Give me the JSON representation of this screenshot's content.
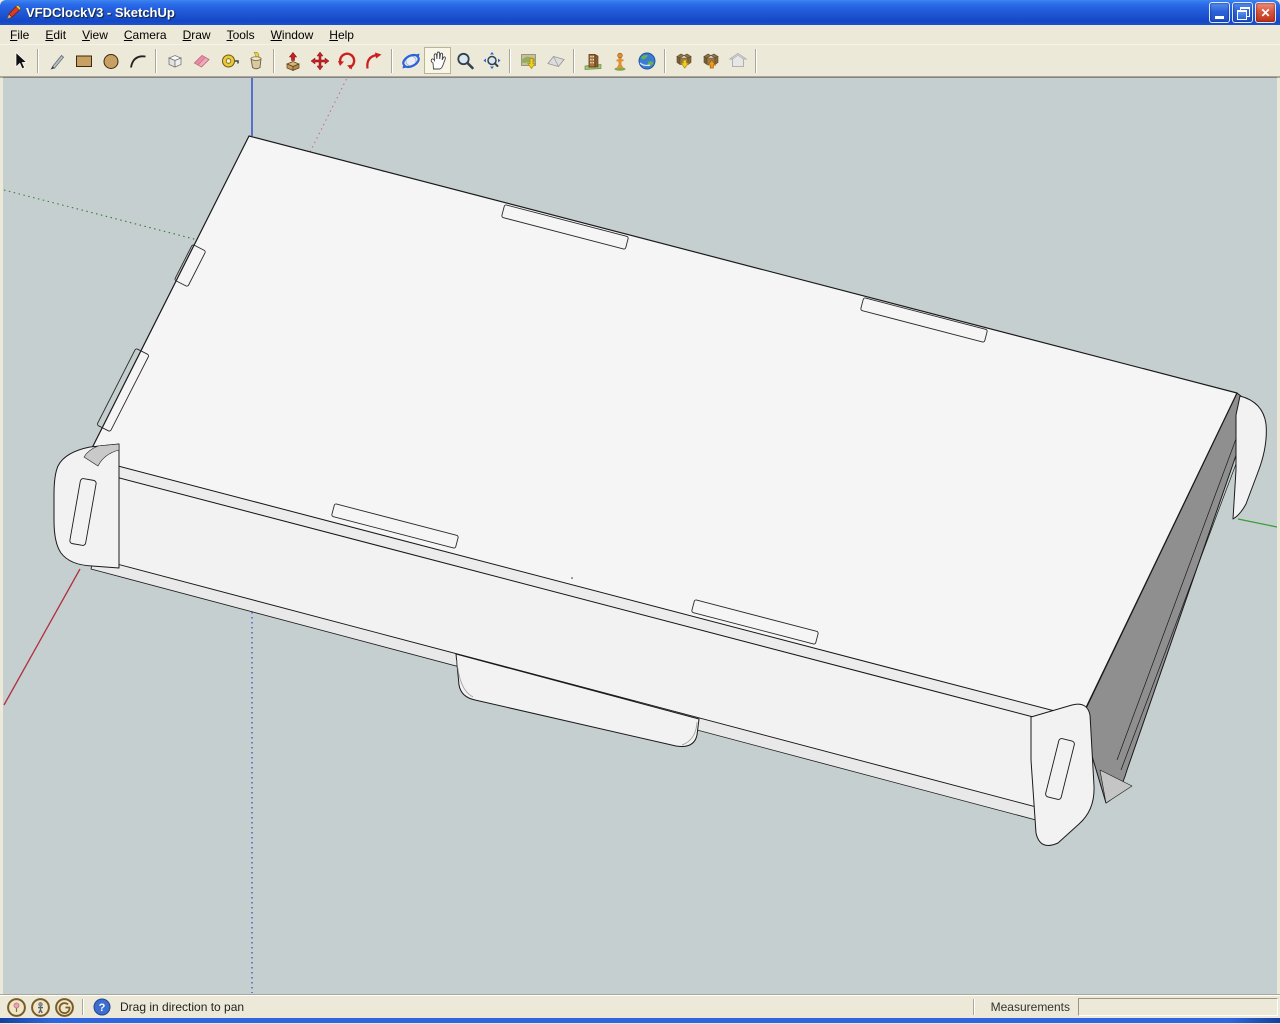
{
  "window": {
    "title": "VFDClockV3 - SketchUp",
    "controls": [
      {
        "name": "minimize"
      },
      {
        "name": "restore"
      },
      {
        "name": "close"
      }
    ]
  },
  "menu": {
    "items": [
      {
        "accel": "F",
        "rest": "ile"
      },
      {
        "accel": "E",
        "rest": "dit"
      },
      {
        "accel": "V",
        "rest": "iew"
      },
      {
        "accel": "C",
        "rest": "amera"
      },
      {
        "accel": "D",
        "rest": "raw"
      },
      {
        "accel": "T",
        "rest": "ools"
      },
      {
        "accel": "W",
        "rest": "indow"
      },
      {
        "accel": "H",
        "rest": "elp"
      }
    ]
  },
  "toolbar": {
    "tools": [
      {
        "name": "Select"
      },
      {
        "name": "Line"
      },
      {
        "name": "Rectangle"
      },
      {
        "name": "Circle"
      },
      {
        "name": "Arc"
      },
      {
        "name": "Make Component"
      },
      {
        "name": "Eraser"
      },
      {
        "name": "Tape Measure"
      },
      {
        "name": "Paint Bucket"
      },
      {
        "name": "Push/Pull"
      },
      {
        "name": "Move"
      },
      {
        "name": "Rotate"
      },
      {
        "name": "Follow Me"
      },
      {
        "name": "Orbit"
      },
      {
        "name": "Pan",
        "active": true
      },
      {
        "name": "Zoom"
      },
      {
        "name": "Zoom Extents"
      },
      {
        "name": "Add Location"
      },
      {
        "name": "Toggle Terrain"
      },
      {
        "name": "Photo Textures"
      },
      {
        "name": "Add New Building"
      },
      {
        "name": "Preview Model in Google Earth"
      },
      {
        "name": "Get Models"
      },
      {
        "name": "Share Model"
      },
      {
        "name": "Share Component"
      }
    ]
  },
  "statusbar": {
    "icons": [
      "geolocation",
      "credits",
      "sign-in"
    ],
    "hint": "Drag in direction to pan",
    "measurements_label": "Measurements",
    "measurements_value": ""
  },
  "colors": {
    "titlebar_top": "#2a6ae9",
    "titlebar_bottom": "#1547c6",
    "chrome": "#ece9d8",
    "canvas_bg": "#c6cfd0",
    "model_face": "#f5f5f5",
    "model_side": "#8f8f8f",
    "axis_red": "#b03040",
    "axis_green": "#35a035",
    "axis_blue": "#1c39c8",
    "edge": "#1a1a1a"
  }
}
